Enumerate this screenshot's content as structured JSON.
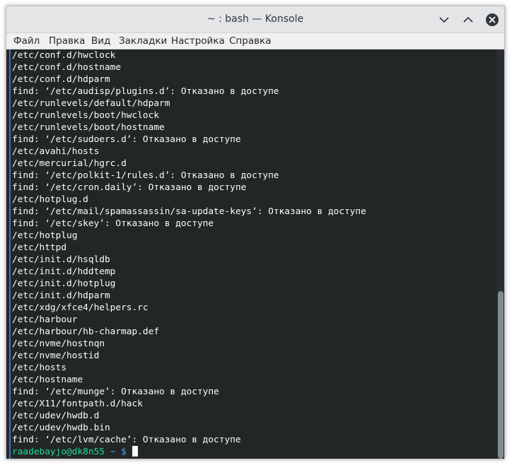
{
  "window": {
    "title": "~ : bash — Konsole"
  },
  "menu": [
    "Файл",
    "Правка",
    "Вид",
    "Закладки",
    "Настройка",
    "Справка"
  ],
  "terminal": {
    "lines": [
      "/etc/conf.d/hwclock",
      "/etc/conf.d/hostname",
      "/etc/conf.d/hdparm",
      "find: ‘/etc/audisp/plugins.d’: Отказано в доступе",
      "/etc/runlevels/default/hdparm",
      "/etc/runlevels/boot/hwclock",
      "/etc/runlevels/boot/hostname",
      "find: ‘/etc/sudoers.d’: Отказано в доступе",
      "/etc/avahi/hosts",
      "/etc/mercurial/hgrc.d",
      "find: ‘/etc/polkit-1/rules.d’: Отказано в доступе",
      "find: ‘/etc/cron.daily’: Отказано в доступе",
      "/etc/hotplug.d",
      "find: ‘/etc/mail/spamassassin/sa-update-keys’: Отказано в доступе",
      "find: ‘/etc/skey’: Отказано в доступе",
      "/etc/hotplug",
      "/etc/httpd",
      "/etc/init.d/hsqldb",
      "/etc/init.d/hddtemp",
      "/etc/init.d/hotplug",
      "/etc/init.d/hdparm",
      "/etc/xdg/xfce4/helpers.rc",
      "/etc/harbour",
      "/etc/harbour/hb-charmap.def",
      "/etc/nvme/hostnqn",
      "/etc/nvme/hostid",
      "/etc/hosts",
      "/etc/hostname",
      "find: ‘/etc/munge’: Отказано в доступе",
      "/etc/X11/fontpath.d/hack",
      "/etc/udev/hwdb.d",
      "/etc/udev/hwdb.bin",
      "find: ‘/etc/lvm/cache’: Отказано в доступе"
    ],
    "prompt": {
      "user_host": "raadebayjo@dk8n55",
      "path": "~",
      "symbol": "$"
    }
  },
  "scrollbar": {
    "thumb_start_fraction": 0.59,
    "thumb_size_fraction": 0.41
  },
  "colors": {
    "terminal_bg": "#232627",
    "terminal_fg": "#fcfcfc",
    "prompt_user": "#1cdc9a",
    "prompt_path": "#3daee9"
  }
}
